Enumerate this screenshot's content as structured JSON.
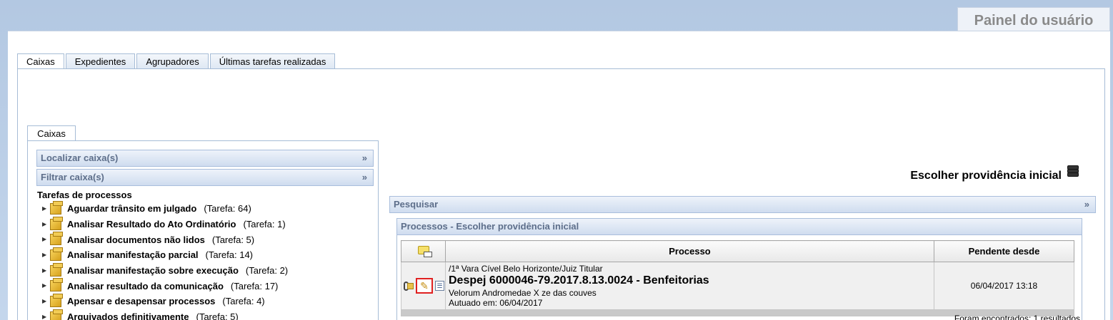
{
  "header": {
    "user_panel_title": "Painel do usuário"
  },
  "tabs": [
    {
      "label": "Caixas",
      "active": true
    },
    {
      "label": "Expedientes",
      "active": false
    },
    {
      "label": "Agrupadores",
      "active": false
    },
    {
      "label": "Últimas tarefas realizadas",
      "active": false
    }
  ],
  "left_panel": {
    "tab_label": "Caixas",
    "locate_label": "Localizar caixa(s)",
    "filter_label": "Filtrar caixa(s)",
    "expand_glyph": "»",
    "tree_title": "Tarefas de processos",
    "tree_items": [
      {
        "name": "Aguardar trânsito em julgado",
        "count": "(Tarefa: 64)"
      },
      {
        "name": "Analisar Resultado do Ato Ordinatório",
        "count": "(Tarefa: 1)"
      },
      {
        "name": "Analisar documentos não lidos",
        "count": "(Tarefa: 5)"
      },
      {
        "name": "Analisar manifestação parcial",
        "count": "(Tarefa: 14)"
      },
      {
        "name": "Analisar manifestação sobre execução",
        "count": "(Tarefa: 2)"
      },
      {
        "name": "Analisar resultado da comunicação",
        "count": "(Tarefa: 17)"
      },
      {
        "name": "Apensar e desapensar processos",
        "count": "(Tarefa: 4)"
      },
      {
        "name": "Arquivados definitivamente",
        "count": "(Tarefa: 5)"
      }
    ]
  },
  "right_panel": {
    "heading": "Escolher providência inicial",
    "search_label": "Pesquisar",
    "results_title": "Processos - Escolher providência inicial",
    "columns": {
      "process": "Processo",
      "pending_since": "Pendente desde"
    },
    "row": {
      "court": "/1ª Vara Cível Belo Horizonte/Juiz Titular",
      "title": "Despej 6000046-79.2017.8.13.0024 - Benfeitorias",
      "parties": "Velorum Andromedae X ze das couves",
      "filed": "Autuado em: 06/04/2017",
      "pending": "06/04/2017 13:18"
    },
    "result_count": "Foram encontrados: 1 resultados"
  },
  "icons": {
    "box": "box-icon",
    "edit": "edit-pencil-icon",
    "note": "note-icon",
    "attachment": "paperclip-icon",
    "choose": "stack-icon"
  },
  "colors": {
    "bar_bg": "#cfdcef",
    "bar_text": "#5d6e8a",
    "highlight_border": "#e02020"
  }
}
